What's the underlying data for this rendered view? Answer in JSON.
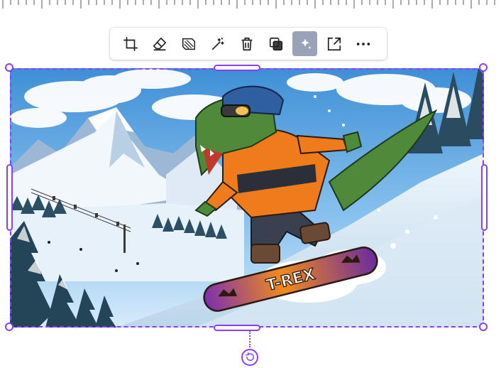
{
  "toolbar": {
    "tools": [
      {
        "name": "crop",
        "icon": "crop-icon"
      },
      {
        "name": "erase",
        "icon": "eraser-icon"
      },
      {
        "name": "background-remover",
        "icon": "bg-remover-icon"
      },
      {
        "name": "magic-edit",
        "icon": "magic-wand-icon"
      },
      {
        "name": "delete",
        "icon": "trash-icon"
      },
      {
        "name": "layer",
        "icon": "layer-icon"
      },
      {
        "name": "ai-sparkle",
        "icon": "sparkle-icon",
        "active": true
      },
      {
        "name": "expand",
        "icon": "expand-icon"
      },
      {
        "name": "more",
        "icon": "more-icon"
      }
    ]
  },
  "canvas": {
    "image_text": "T-REX",
    "selection_color": "#8b3dff",
    "active_tool_bg": "#9aa2b8"
  }
}
